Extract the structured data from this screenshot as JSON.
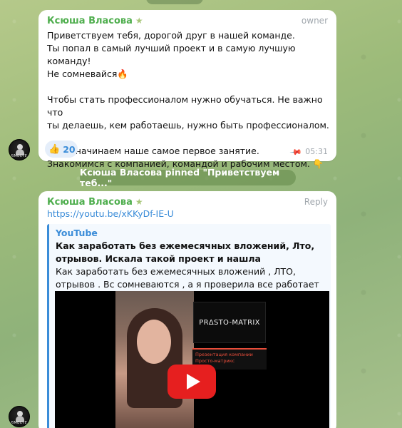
{
  "messages": [
    {
      "sender": "Ксюша Власова",
      "role": "owner",
      "text": "Приветствуем тебя, дорогой друг в нашей команде.\nТы попал в самый лучший проект и в самую лучшую команду!\nНе сомневайся🔥\n\nЧтобы стать профессионалом нужно обучаться. Не важно что\nты делаешь, кем работаешь, нужно быть профессионалом.\n\nИтак, начинаем наше самое первое занятие.\nЗнакомимся с компанией, командой и рабочим местом.  👇",
      "reaction": {
        "emoji": "👍",
        "count": "20"
      },
      "time": "05:31",
      "pinned": true
    },
    {
      "sender": "Ксюша Власова",
      "reply_label": "Reply",
      "link": "https://youtu.be/xKKyDf-IE-U",
      "preview": {
        "site": "YouTube",
        "title": "Как заработать без ежемесячных вложений, Лто, отрывов. Искала такой проект и нашла",
        "description": "Как заработать без ежемесячных вложений , ЛТО, отрывов . Вс сомневаются , а я проверила все работает как часы. Реко...",
        "thumbnail_brand": "PRΔSTO-MATRIX",
        "thumbnail_caption": "Презентация компании Просто-матрикс"
      }
    }
  ],
  "service_message": "Ксюша Власова pinned \"Приветствуем теб...\"",
  "avatar_label": "ВМЕСТЕ",
  "colors": {
    "sender": "#4fae4e",
    "link": "#3a8cd8",
    "play": "#e61f1f"
  }
}
